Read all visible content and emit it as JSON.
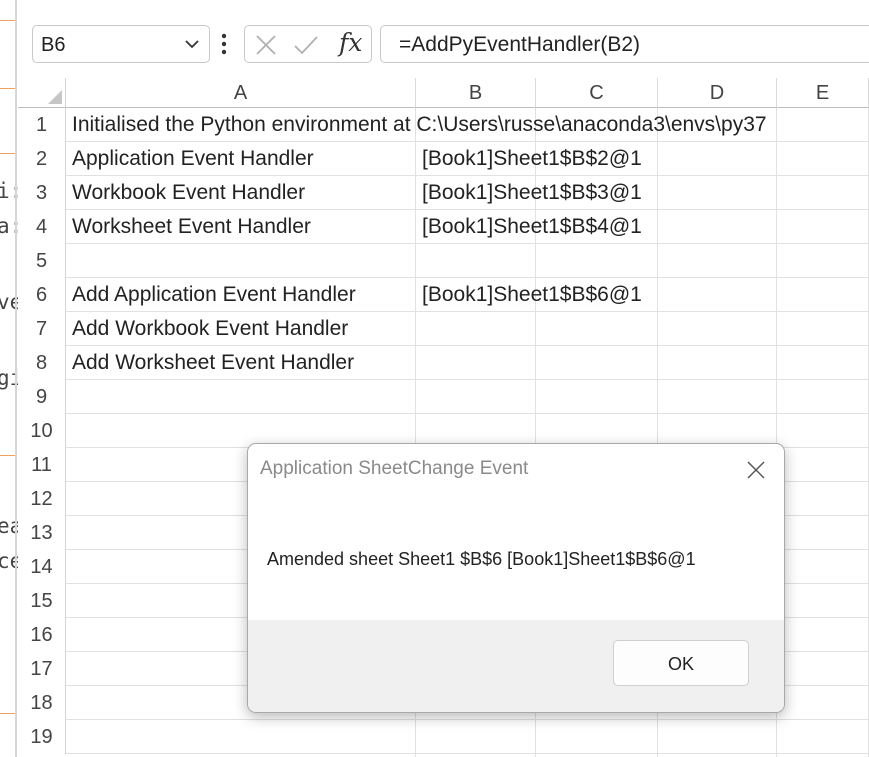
{
  "left_strip": {
    "fragments": [
      "i:",
      "a:",
      "ve",
      "gi",
      "ea",
      "ce"
    ]
  },
  "formula_bar": {
    "name_box_value": "B6",
    "cancel_icon": "x-icon",
    "enter_icon": "check-icon",
    "fx_label": "fx",
    "formula": "=AddPyEventHandler(B2)"
  },
  "grid": {
    "columns": [
      "A",
      "B",
      "C",
      "D",
      "E"
    ],
    "rows": [
      "1",
      "2",
      "3",
      "4",
      "5",
      "6",
      "7",
      "8",
      "9",
      "10",
      "11",
      "12",
      "13",
      "14",
      "15",
      "16",
      "17",
      "18",
      "19"
    ],
    "cells": {
      "A1": "Initialised the Python environment at C:\\Users\\russe\\anaconda3\\envs\\py37",
      "A2": "Application Event Handler",
      "B2": "[Book1]Sheet1$B$2@1",
      "A3": "Workbook Event Handler",
      "B3": "[Book1]Sheet1$B$3@1",
      "A4": "Worksheet Event Handler",
      "B4": "[Book1]Sheet1$B$4@1",
      "A6": "Add Application Event Handler",
      "B6": "[Book1]Sheet1$B$6@1",
      "A7": "Add Workbook Event Handler",
      "A8": "Add Worksheet Event Handler"
    }
  },
  "dialog": {
    "title": "Application SheetChange Event",
    "message": "Amended sheet Sheet1 $B$6 [Book1]Sheet1$B$6@1",
    "ok_label": "OK"
  },
  "colors": {
    "grid_line": "#e1e1e1",
    "header_text": "#444444",
    "dialog_footer": "#f0f0f0"
  }
}
